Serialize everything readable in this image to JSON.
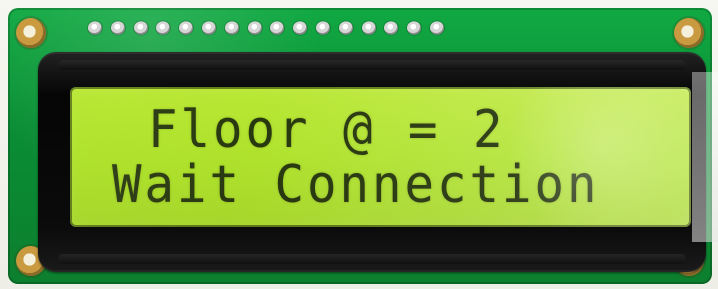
{
  "lcd_display": {
    "line1": "Floor @ = 2",
    "line2": "Wait Connection"
  }
}
